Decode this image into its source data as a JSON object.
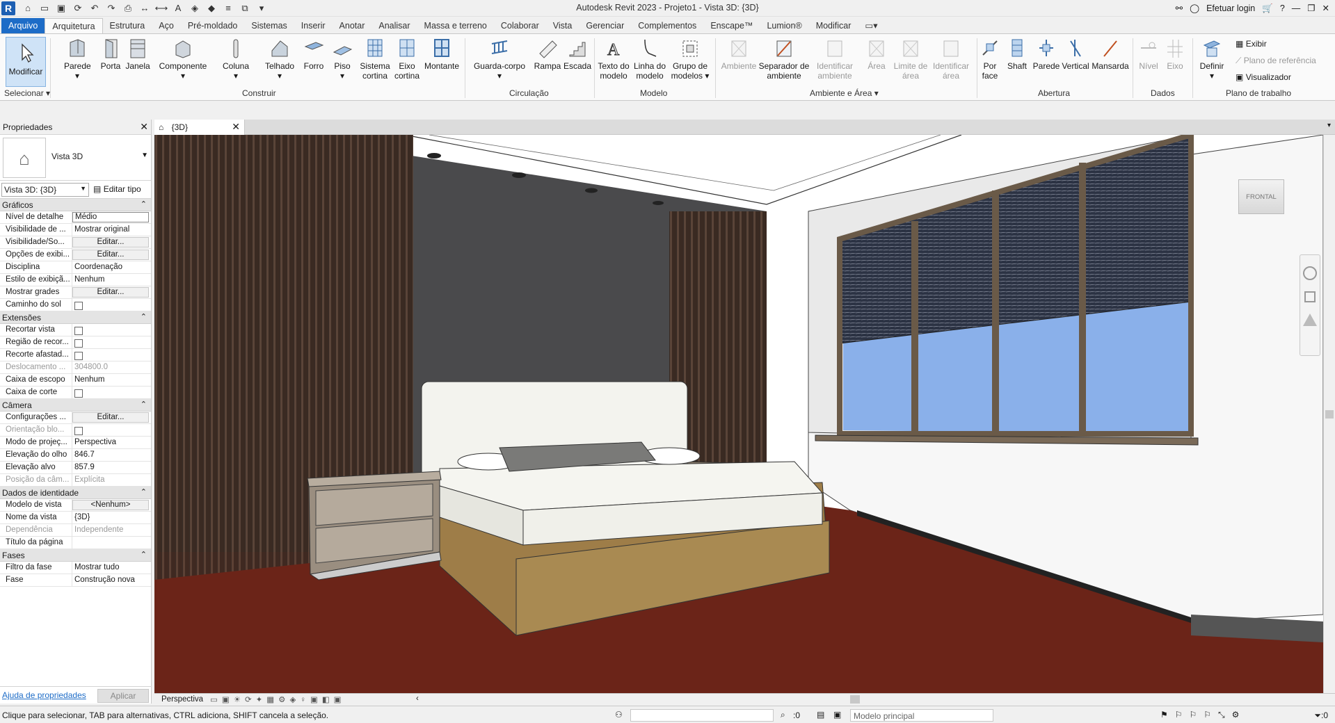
{
  "app": {
    "title": "Autodesk Revit 2023 - Projeto1 - Vista 3D: {3D}",
    "logo_letter": "R",
    "login": "Efetuar login"
  },
  "menu": {
    "file": "Arquivo",
    "tabs": [
      "Arquitetura",
      "Estrutura",
      "Aço",
      "Pré-moldado",
      "Sistemas",
      "Inserir",
      "Anotar",
      "Analisar",
      "Massa e terreno",
      "Colaborar",
      "Vista",
      "Gerenciar",
      "Complementos",
      "Enscape™",
      "Lumion®",
      "Modificar"
    ]
  },
  "ribbon": {
    "select": {
      "modify": "Modificar",
      "panel": "Selecionar"
    },
    "build": {
      "panel": "Construir",
      "tools": [
        "Parede",
        "Porta",
        "Janela",
        "Componente",
        "Coluna",
        "Telhado",
        "Forro",
        "Piso",
        "Sistema cortina",
        "Eixo cortina",
        "Montante"
      ]
    },
    "circulation": {
      "panel": "Circulação",
      "tools": [
        "Guarda-corpo",
        "Rampa",
        "Escada"
      ]
    },
    "model": {
      "panel": "Modelo",
      "tools": [
        "Texto do modelo",
        "Linha do modelo",
        "Grupo de modelos"
      ]
    },
    "room": {
      "panel": "Ambiente e Área",
      "tools": [
        "Ambiente",
        "Separador de ambiente",
        "Identificar ambiente",
        "Área",
        "Limite de área",
        "Identificar área"
      ]
    },
    "opening": {
      "panel": "Abertura",
      "tools": [
        "Por face",
        "Shaft",
        "Parede",
        "Vertical",
        "Mansarda"
      ]
    },
    "datum": {
      "panel": "Dados",
      "tools": [
        "Nível",
        "Eixo"
      ]
    },
    "workplane": {
      "panel": "Plano de trabalho",
      "define": "Definir",
      "show": "Exibir",
      "ref_plane": "Plano de referência",
      "viewer": "Visualizador"
    }
  },
  "properties": {
    "title": "Propriedades",
    "type_name": "Vista 3D",
    "view_selector": "Vista 3D: {3D}",
    "edit_type": "Editar tipo",
    "sections": [
      {
        "name": "Gráficos",
        "rows": [
          {
            "k": "Nível de detalhe",
            "v": "Médio",
            "kind": "inp"
          },
          {
            "k": "Visibilidade de ...",
            "v": "Mostrar original",
            "kind": "text"
          },
          {
            "k": "Visibilidade/So...",
            "v": "Editar...",
            "kind": "btn"
          },
          {
            "k": "Opções de exibi...",
            "v": "Editar...",
            "kind": "btn"
          },
          {
            "k": "Disciplina",
            "v": "Coordenação",
            "kind": "text"
          },
          {
            "k": "Estilo de exibiçã...",
            "v": "Nenhum",
            "kind": "text"
          },
          {
            "k": "Mostrar grades",
            "v": "Editar...",
            "kind": "btn"
          },
          {
            "k": "Caminho do sol",
            "v": "",
            "kind": "cb"
          }
        ]
      },
      {
        "name": "Extensões",
        "rows": [
          {
            "k": "Recortar vista",
            "v": "",
            "kind": "cb"
          },
          {
            "k": "Região de recor...",
            "v": "",
            "kind": "cb"
          },
          {
            "k": "Recorte afastad...",
            "v": "",
            "kind": "cb"
          },
          {
            "k": "Deslocamento ...",
            "v": "304800.0",
            "kind": "dim"
          },
          {
            "k": "Caixa de escopo",
            "v": "Nenhum",
            "kind": "text"
          },
          {
            "k": "Caixa de corte",
            "v": "",
            "kind": "cb"
          }
        ]
      },
      {
        "name": "Câmera",
        "rows": [
          {
            "k": "Configurações ...",
            "v": "Editar...",
            "kind": "btn"
          },
          {
            "k": "Orientação blo...",
            "v": "",
            "kind": "dimcb"
          },
          {
            "k": "Modo de projeç...",
            "v": "Perspectiva",
            "kind": "text"
          },
          {
            "k": "Elevação do olho",
            "v": "846.7",
            "kind": "text"
          },
          {
            "k": "Elevação alvo",
            "v": "857.9",
            "kind": "text"
          },
          {
            "k": "Posição da câm...",
            "v": "Explícita",
            "kind": "dim"
          }
        ]
      },
      {
        "name": "Dados de identidade",
        "rows": [
          {
            "k": "Modelo de vista",
            "v": "<Nenhum>",
            "kind": "btn"
          },
          {
            "k": "Nome da vista",
            "v": "{3D}",
            "kind": "text"
          },
          {
            "k": "Dependência",
            "v": "Independente",
            "kind": "dim"
          },
          {
            "k": "Título da página",
            "v": "",
            "kind": "text"
          }
        ]
      },
      {
        "name": "Fases",
        "rows": [
          {
            "k": "Filtro da fase",
            "v": "Mostrar tudo",
            "kind": "text"
          },
          {
            "k": "Fase",
            "v": "Construção nova",
            "kind": "text"
          }
        ]
      }
    ],
    "help": "Ajuda de propriedades",
    "apply": "Aplicar"
  },
  "view": {
    "tab": "{3D}",
    "viewcube_label": "FRONTAL",
    "scale": "Perspectiva"
  },
  "status": {
    "message": "Clique para selecionar, TAB para alternativas, CTRL adiciona, SHIFT cancela a seleção.",
    "zero": ":0",
    "model": "Modelo principal",
    "filter": ":0"
  },
  "colors": {
    "accent": "#1d6cc7",
    "floor": "#6b2418",
    "slats": "#3a2a22",
    "glass": "#8ab0ea",
    "accent_wall": "#4a4a4c"
  }
}
